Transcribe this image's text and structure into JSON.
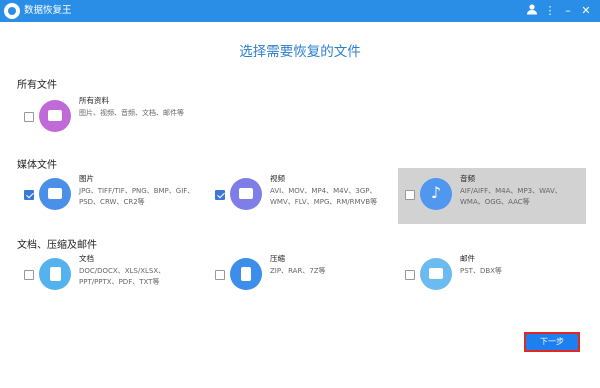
{
  "app": {
    "title": "数据恢复王"
  },
  "page_title": "选择需要恢复的文件",
  "sections": {
    "all": "所有文件",
    "media": "媒体文件",
    "docs": "文档、压缩及邮件"
  },
  "cards": {
    "all": {
      "title": "所有资料",
      "desc": "图片、视频、音频、文档、邮件等",
      "checked": false
    },
    "image": {
      "title": "图片",
      "desc": "JPG、TIFF/TIF、PNG、BMP、GIF、PSD、CRW、CR2等",
      "checked": true
    },
    "video": {
      "title": "视频",
      "desc": "AVI、MOV、MP4、M4V、3GP、WMV、FLV、MPG、RM/RMVB等",
      "checked": true
    },
    "audio": {
      "title": "音频",
      "desc": "AIF/AIFF、M4A、MP3、WAV、WMA、OGG、AAC等",
      "checked": false
    },
    "doc": {
      "title": "文档",
      "desc": "DOC/DOCX、XLS/XLSX、PPT/PPTX、PDF、TXT等",
      "checked": false
    },
    "zip": {
      "title": "压缩",
      "desc": "ZIP、RAR、7Z等",
      "checked": false
    },
    "mail": {
      "title": "邮件",
      "desc": "PST、DBX等",
      "checked": false
    }
  },
  "icons": {
    "app_logo": "app-logo-icon",
    "user": "user-icon",
    "menu": "more-menu-icon",
    "minimize": "minimize-icon",
    "close": "close-icon"
  },
  "colors": {
    "titlebar": "#2b8ee6",
    "accent": "#2b7fd0",
    "button": "#1e7ff0",
    "button_border": "#e0281d",
    "selected_card": "#d2d2d2"
  },
  "buttons": {
    "next": "下一步"
  }
}
